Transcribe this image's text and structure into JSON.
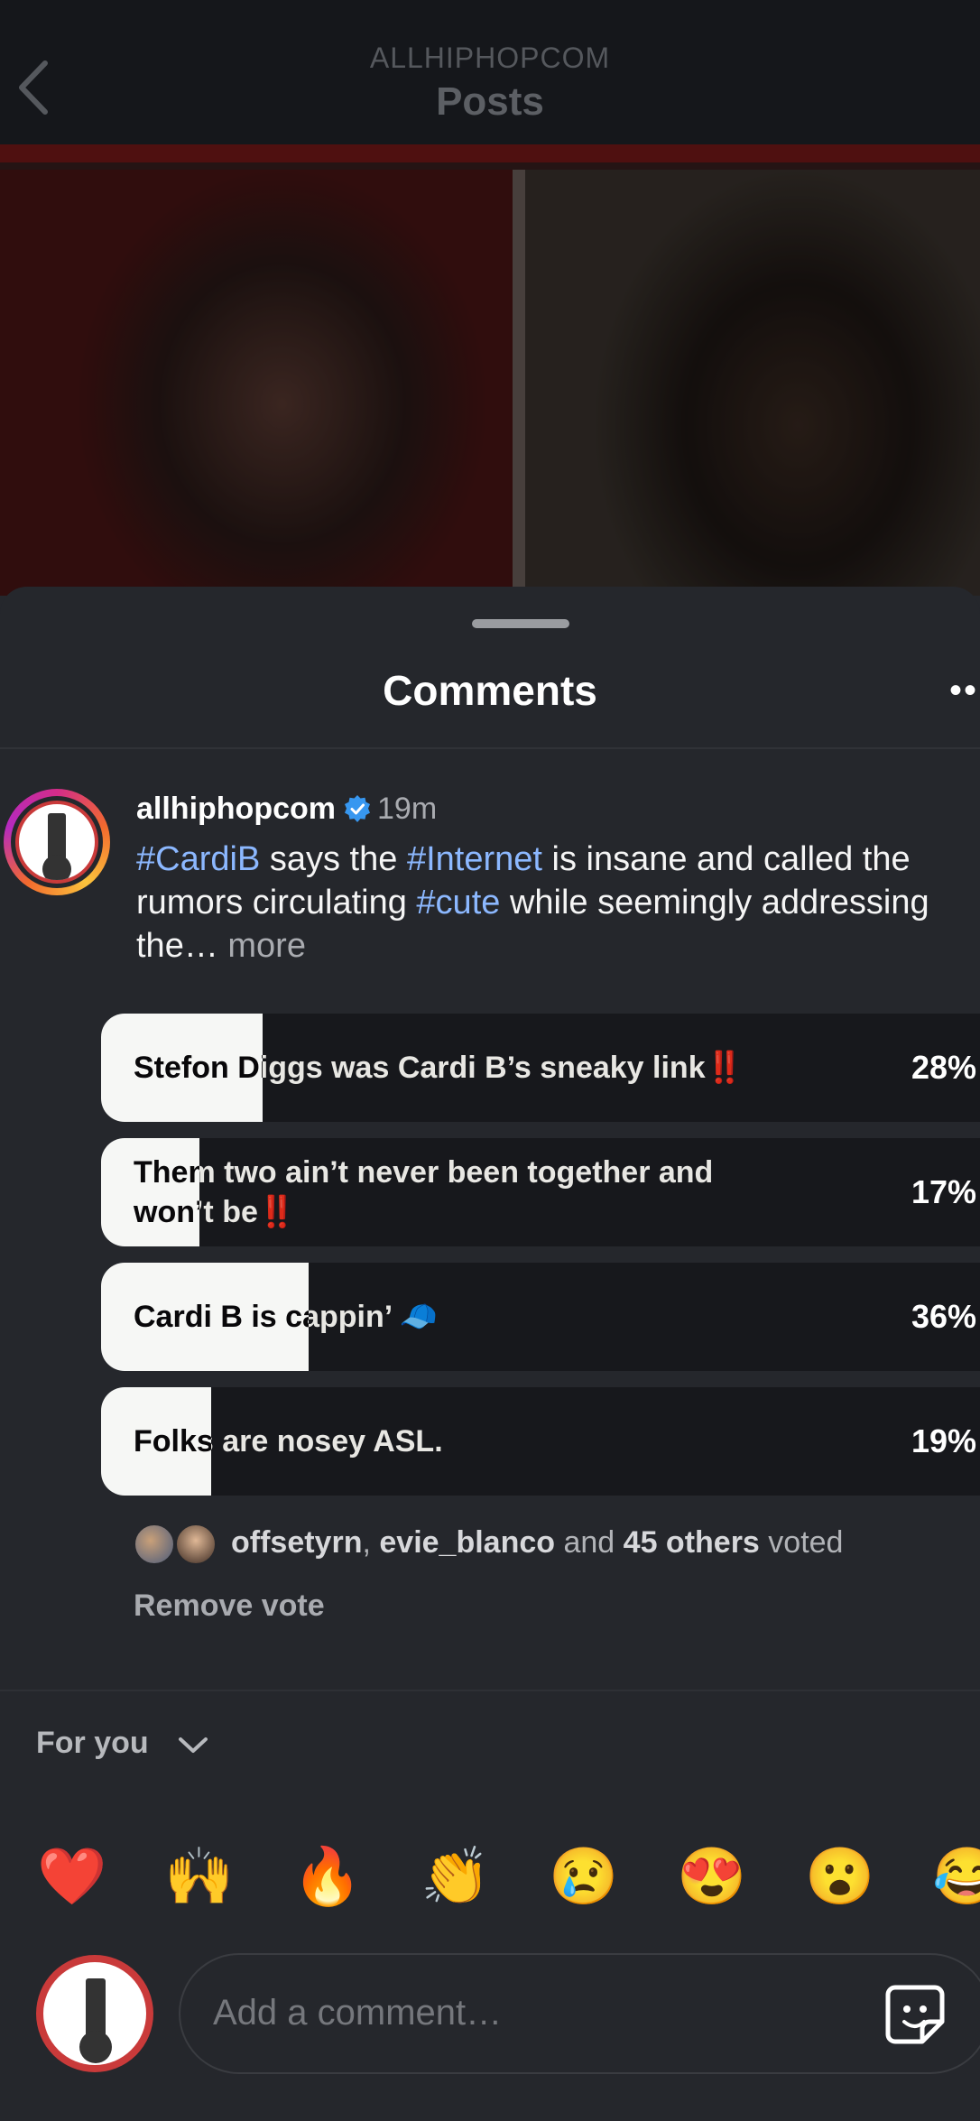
{
  "header": {
    "account": "ALLHIPHOPCOM",
    "title": "Posts"
  },
  "sheet": {
    "title": "Comments"
  },
  "caption": {
    "username": "allhiphopcom",
    "time": "19m",
    "tag1": "#CardiB",
    "text1": " says the ",
    "tag2": "#Internet",
    "text2": " is insane and called the rumors circulating ",
    "tag3": "#cute",
    "text3": " while seemingly addressing the… ",
    "more": "more"
  },
  "poll": {
    "options": [
      {
        "label": "Stefon Diggs was Cardi B’s sneaky link‼️",
        "percent_label": "28%",
        "percent": 28
      },
      {
        "label": "Them two ain’t never been together and won’t be‼️",
        "percent_label": "17%",
        "percent": 17
      },
      {
        "label": "Cardi B is cappin’ 🧢",
        "percent_label": "36%",
        "percent": 36
      },
      {
        "label": "Folks are nosey ASL.",
        "percent_label": "19%",
        "percent": 19
      }
    ],
    "voters": {
      "user1": "offsetyrn",
      "comma": ", ",
      "user2": "evie_blanco",
      "and": " and ",
      "others": "45 others",
      "voted": " voted"
    },
    "remove_vote": "Remove vote"
  },
  "filter": {
    "label": "For you"
  },
  "reactions": [
    "❤️",
    "🙌",
    "🔥",
    "👏",
    "😢",
    "😍",
    "😮",
    "😂"
  ],
  "composer": {
    "placeholder": "Add a comment…"
  },
  "colors": {
    "background": "#25272c",
    "hashtag": "#8cb8ff",
    "verified": "#3797f0"
  }
}
